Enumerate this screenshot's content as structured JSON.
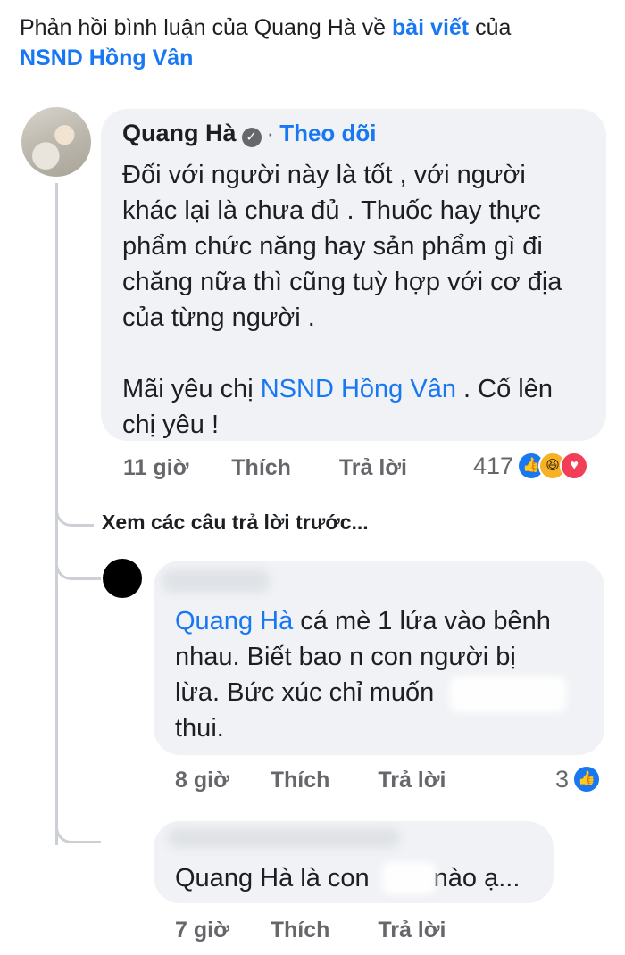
{
  "header": {
    "prefix": "Phản hồi bình luận của Quang Hà về ",
    "link_post": "bài viết",
    "middle": " của",
    "link_page": "NSND Hồng Vân"
  },
  "main_comment": {
    "author": "Quang Hà",
    "verified_icon": "check-badge-icon",
    "follow_label": "Theo dõi",
    "lines": [
      "Đối với người này là tốt , với người",
      "khác lại là chưa đủ . Thuốc hay thực",
      "phẩm chức năng hay sản phẩm gì đi",
      "chăng nữa thì cũng tuỳ hợp với cơ địa",
      "của từng người ."
    ],
    "line2_a": "Mãi yêu chị ",
    "line2_mention": "NSND Hồng Vân",
    "line2_b": "  . Cố lên",
    "line3": "chị yêu !",
    "time": "11 giờ",
    "like_label": "Thích",
    "reply_label": "Trả lời",
    "reaction_count": "417"
  },
  "view_previous": "Xem các câu trả lời trước...",
  "reply1": {
    "mention": "Quang Hà",
    "text_1": "  cá mè 1 lứa vào bênh",
    "text_2": "nhau. Biết bao n con người bị",
    "text_3": "lừa. Bức xúc chỉ muốn",
    "text_4": "thui.",
    "time": "8 giờ",
    "like_label": "Thích",
    "reply_label": "Trả lời",
    "reaction_count": "3"
  },
  "reply2": {
    "text_a": "Quang Hà là con",
    "text_b": "nào ạ...",
    "time": "7 giờ",
    "like_label": "Thích",
    "reply_label": "Trả lời"
  },
  "colors": {
    "link": "#1877f2",
    "bubble": "#f0f2f5",
    "meta": "#65676b"
  }
}
